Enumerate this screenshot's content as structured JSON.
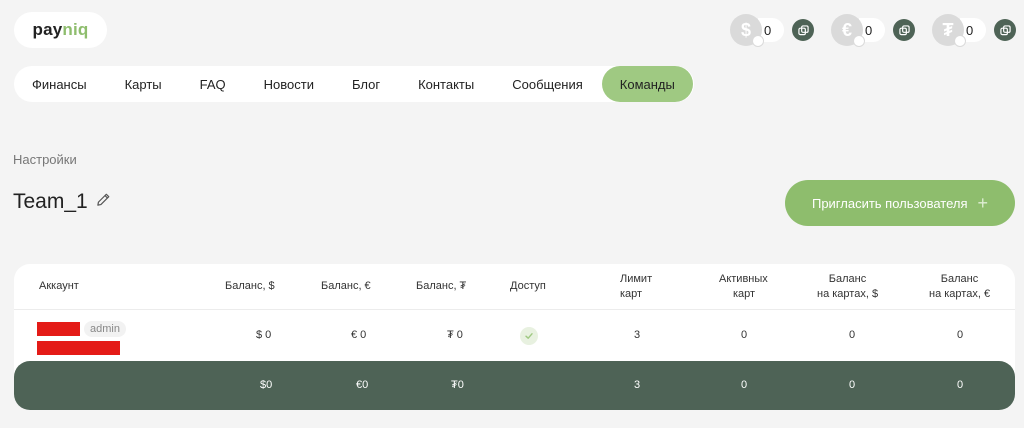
{
  "logo": {
    "part1": "pay",
    "part2": "niq"
  },
  "balances": [
    {
      "symbol": "$",
      "value": "0",
      "icon": "dollar-coin-icon"
    },
    {
      "symbol": "€",
      "value": "0",
      "icon": "euro-coin-icon"
    },
    {
      "symbol": "₮",
      "value": "0",
      "icon": "tether-coin-icon"
    }
  ],
  "nav": {
    "items": [
      "Финансы",
      "Карты",
      "FAQ",
      "Новости",
      "Блог",
      "Контакты",
      "Сообщения",
      "Команды"
    ],
    "active": "Команды"
  },
  "breadcrumb": "Настройки",
  "team": {
    "title": "Team_1"
  },
  "invite_label": "Пригласить пользователя",
  "table": {
    "headers": {
      "account": "Аккаунт",
      "bal_usd": "Баланс, $",
      "bal_eur": "Баланс, €",
      "bal_usdt": "Баланс, ₮",
      "access": "Доступ",
      "limit_1": "Лимит",
      "limit_2": "карт",
      "active_1": "Активных",
      "active_2": "карт",
      "cards_usd_1": "Баланс",
      "cards_usd_2": "на картах, $",
      "cards_eur_1": "Баланс",
      "cards_eur_2": "на картах, €"
    },
    "row": {
      "role": "admin",
      "bal_usd": "$ 0",
      "bal_eur": "€ 0",
      "bal_usdt": "₮ 0",
      "limit": "3",
      "active": "0",
      "cards_usd": "0",
      "cards_eur": "0"
    },
    "totals": {
      "bal_usd": "$0",
      "bal_eur": "€0",
      "bal_usdt": "₮0",
      "limit": "3",
      "active": "0",
      "cards_usd": "0",
      "cards_eur": "0"
    }
  },
  "colors": {
    "accent": "#9fc982",
    "button": "#8ebd6d",
    "dark": "#4e6356",
    "redact": "#e41b17"
  }
}
